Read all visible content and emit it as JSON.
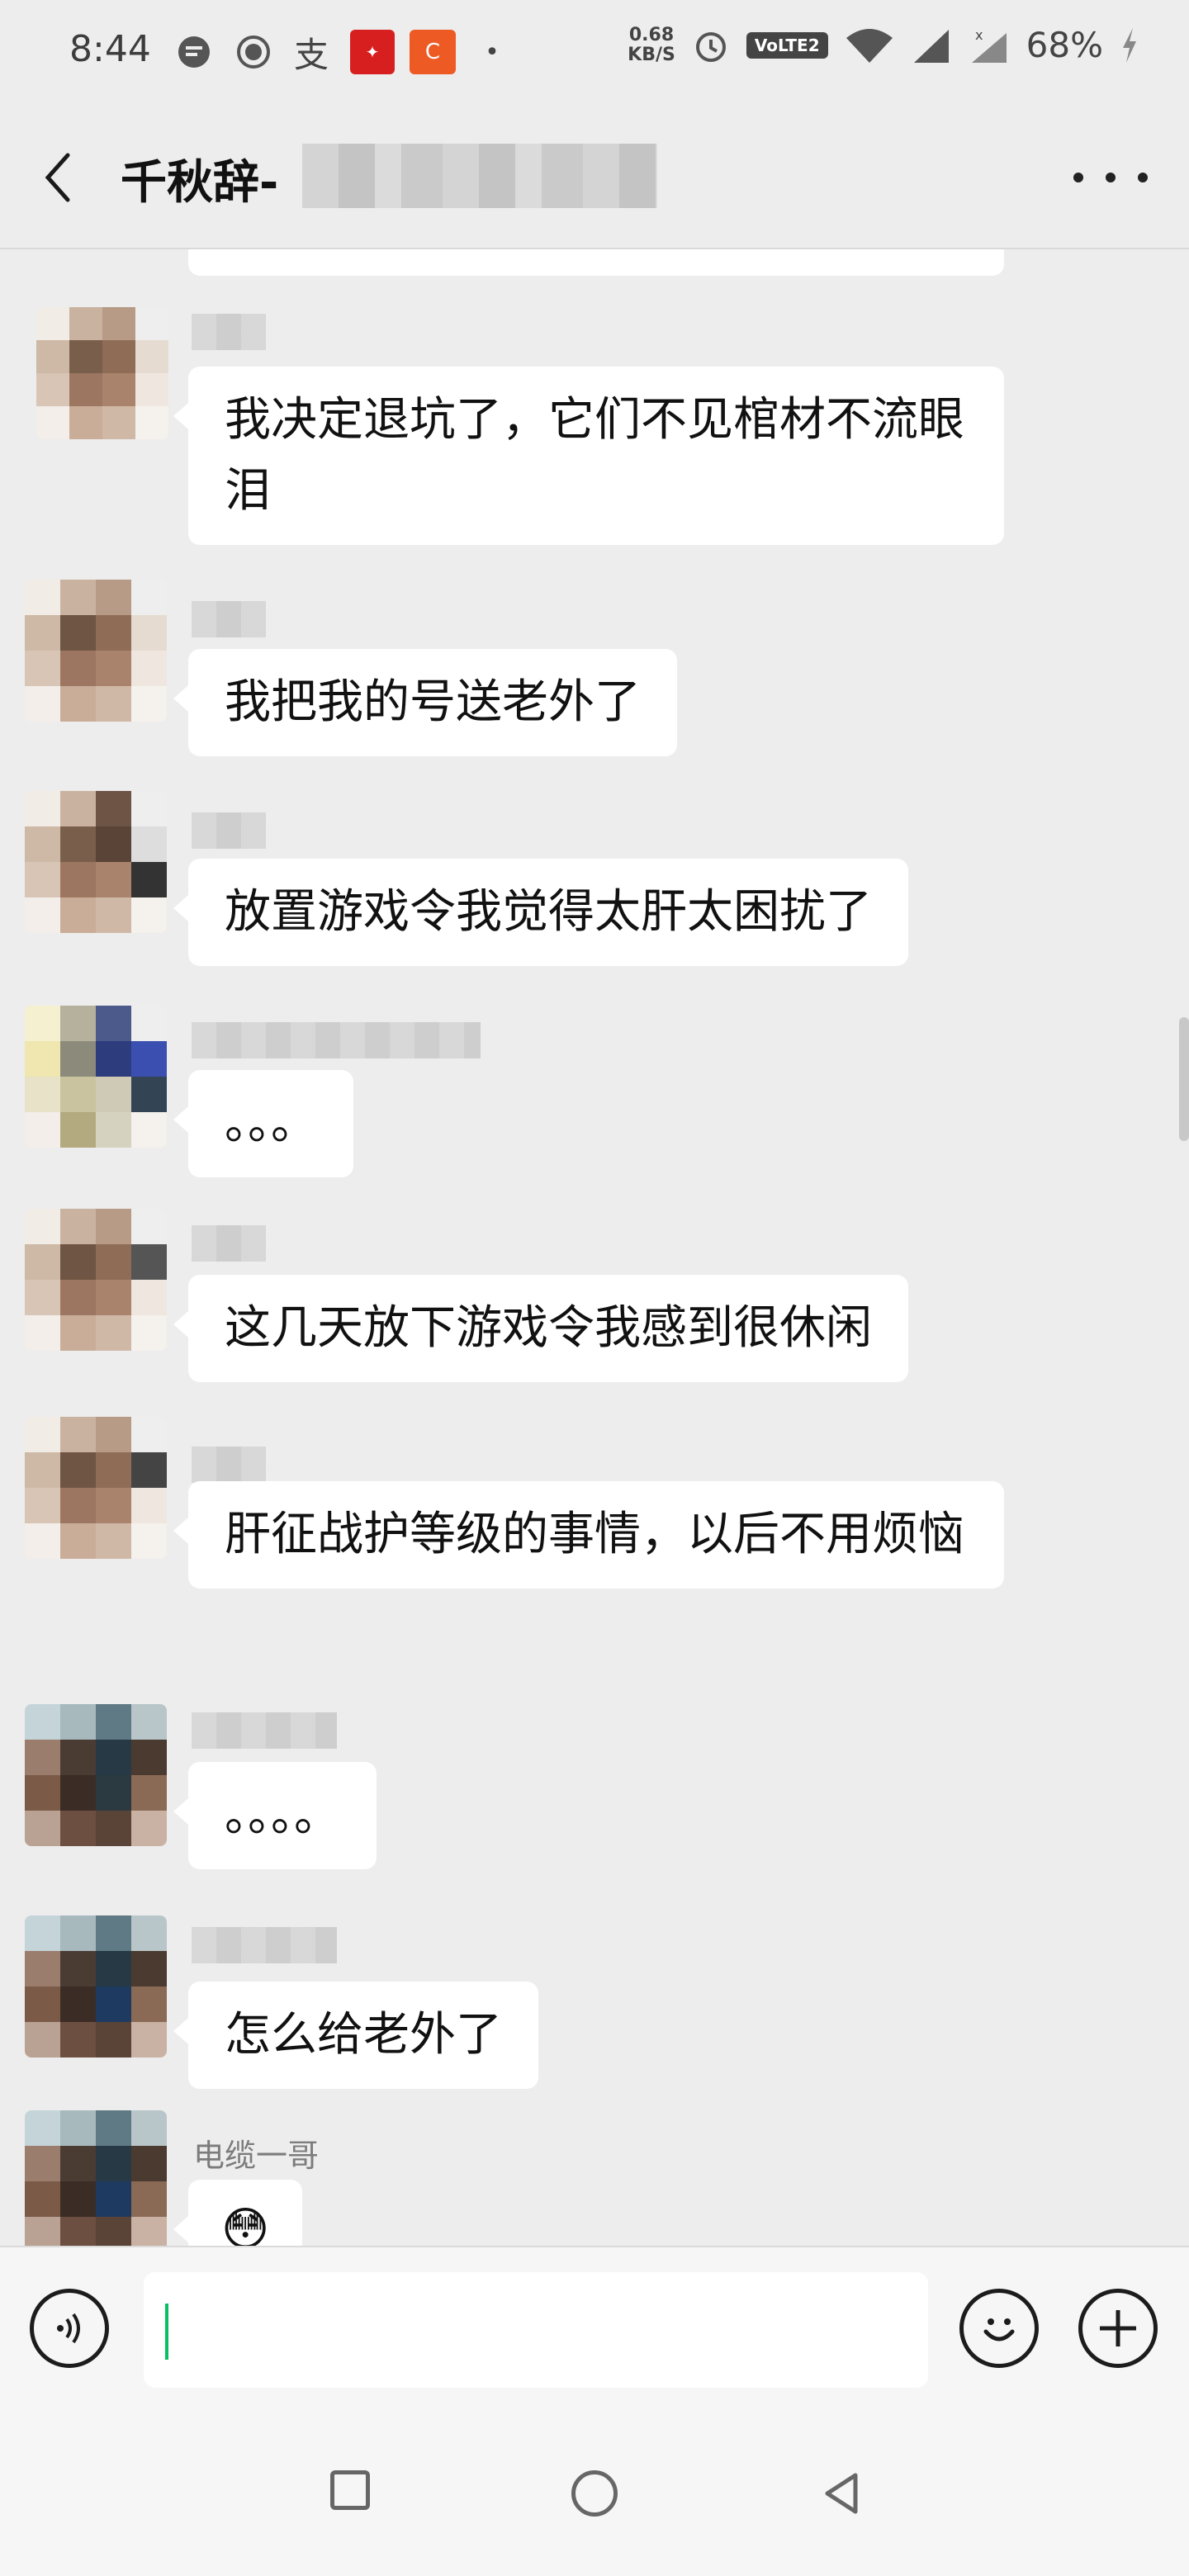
{
  "status_bar": {
    "time": "8:44",
    "net_speed_value": "0.68",
    "net_speed_unit": "KB/S",
    "volte": "VoLTE2",
    "battery": "68%"
  },
  "header": {
    "title": "千秋辞-"
  },
  "messages": [
    {
      "nickname": "",
      "text": "我决定退坑了，它们不见棺材不流眼泪"
    },
    {
      "nickname": "",
      "text": "我把我的号送老外了"
    },
    {
      "nickname": "",
      "text": "放置游戏令我觉得太肝太困扰了"
    },
    {
      "nickname": "",
      "text": "。。。"
    },
    {
      "nickname": "",
      "text": "这几天放下游戏令我感到很休闲"
    },
    {
      "nickname": "",
      "text": "肝征战护等级的事情，以后不用烦恼"
    },
    {
      "nickname": "",
      "text": "。。。。"
    },
    {
      "nickname": "",
      "text": "怎么给老外了"
    },
    {
      "nickname": "电缆一哥",
      "text": "😳"
    }
  ],
  "colors": {
    "background": "#ededed",
    "bubble": "#ffffff",
    "caret": "#07c160"
  },
  "icons": {
    "back": "chevron-left-icon",
    "more": "more-dots-icon",
    "voice": "voice-icon",
    "emoji": "emoji-icon",
    "plus": "plus-icon"
  }
}
